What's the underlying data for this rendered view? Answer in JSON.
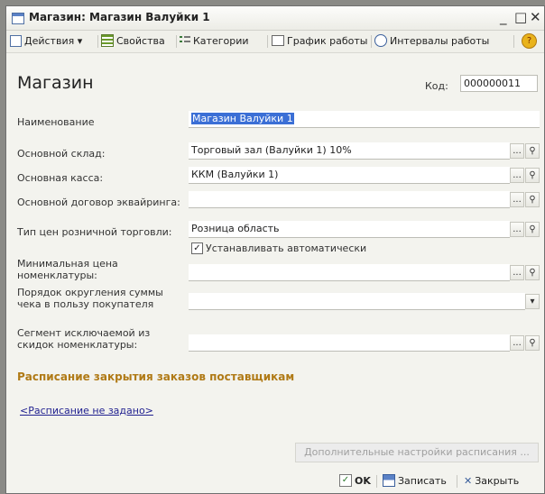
{
  "window": {
    "title": "Магазин: Магазин Валуйки 1"
  },
  "toolbar": {
    "actions": "Действия",
    "properties": "Свойства",
    "categories": "Категории",
    "schedule": "График работы",
    "intervals": "Интервалы работы"
  },
  "form": {
    "heading": "Магазин",
    "code_label": "Код:",
    "code_value": "000000011",
    "name_label": "Наименование",
    "name_value": "Магазин Валуйки 1",
    "warehouse_label": "Основной склад:",
    "warehouse_value": "Торговый зал (Валуйки 1) 10%",
    "cash_label": "Основная касса:",
    "cash_value": "ККМ (Валуйки 1)",
    "acquiring_label": "Основной договор эквайринга:",
    "acquiring_value": "",
    "price_type_label": "Тип цен розничной торговли:",
    "price_type_value": "Розница область",
    "auto_set_label": "Устанавливать автоматически",
    "auto_set_checked": true,
    "min_price_label_1": "Минимальная цена",
    "min_price_label_2": "номенклатуры:",
    "min_price_value": "",
    "rounding_label_1": "Порядок округления суммы",
    "rounding_label_2": "чека в пользу покупателя",
    "rounding_value": "",
    "segment_label_1": "Сегмент исключаемой из",
    "segment_label_2": "скидок номенклатуры:",
    "segment_value": "",
    "schedule_section": "Расписание закрытия заказов поставщикам",
    "schedule_link": "<Расписание не задано>",
    "extra_settings": "Дополнительные настройки расписания ..."
  },
  "buttons": {
    "ok": "OK",
    "save": "Записать",
    "close": "Закрыть"
  },
  "colors": {
    "section": "#b07a16",
    "link": "#1f1f8f",
    "selection": "#3b6fd6"
  }
}
